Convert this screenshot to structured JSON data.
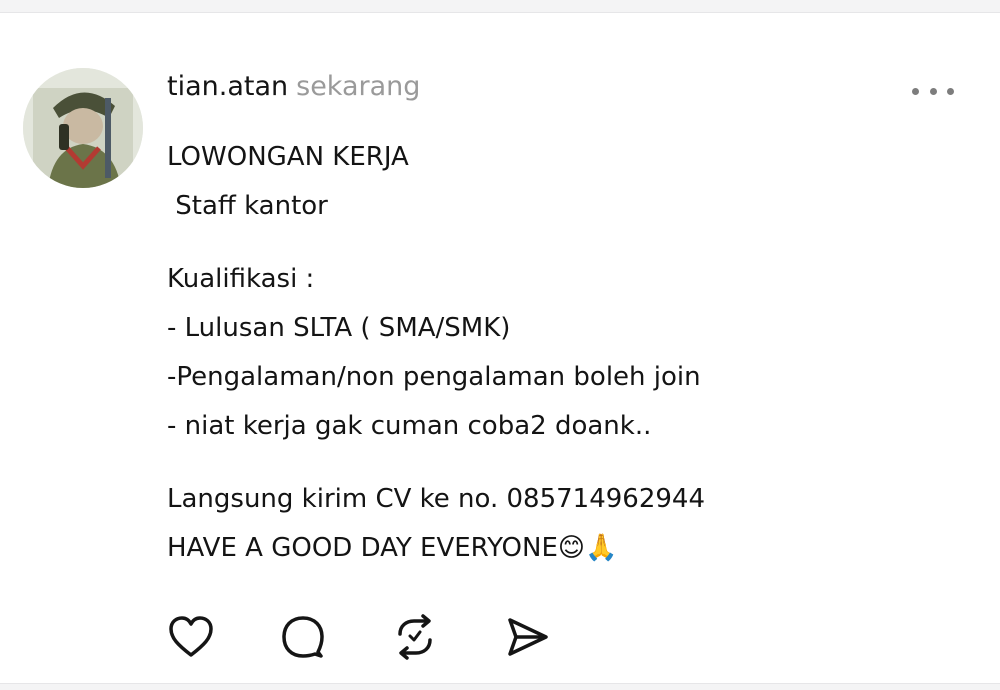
{
  "post": {
    "username": "tian.atan",
    "timestamp": "sekarang",
    "lines": [
      "LOWONGAN KERJA",
      " Staff kantor",
      "",
      "Kualifikasi :",
      "- Lulusan SLTA ( SMA/SMK)",
      "-Pengalaman/non pengalaman boleh join",
      "- niat kerja gak cuman coba2 doank..",
      "",
      "Langsung kirim CV ke no. 085714962944",
      "HAVE A GOOD DAY EVERYONE😊🙏"
    ]
  },
  "icons": {
    "avatar": "avatar-illustration",
    "more": "more-horizontal-icon",
    "like": "heart-icon",
    "comment": "comment-bubble-icon",
    "repost": "repost-icon",
    "share": "send-icon"
  }
}
